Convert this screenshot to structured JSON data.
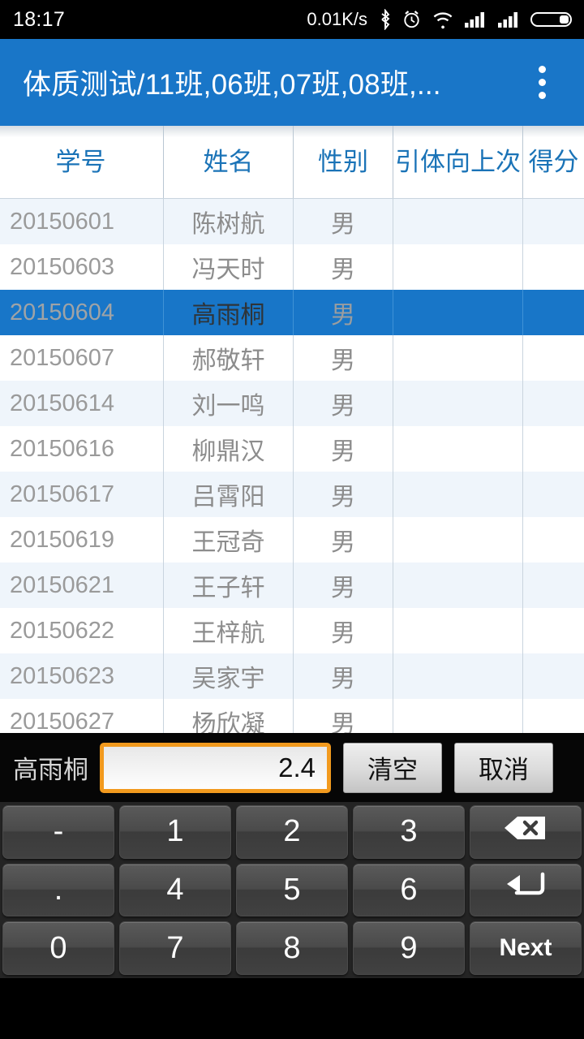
{
  "status_bar": {
    "time": "18:17",
    "network_speed": "0.01K/s",
    "icons": [
      "bluetooth-icon",
      "alarm-icon",
      "wifi-icon",
      "signal-icon",
      "signal-icon",
      "battery-icon"
    ]
  },
  "action_bar": {
    "title": "体质测试/11班,06班,07班,08班,...",
    "overflow_icon": "overflow-menu-icon"
  },
  "table": {
    "columns": [
      "学号",
      "姓名",
      "性别",
      "引体向上次",
      "得分"
    ],
    "rows": [
      {
        "id": "20150601",
        "name": "陈树航",
        "sex": "男",
        "pull": "",
        "score": "",
        "selected": false
      },
      {
        "id": "20150603",
        "name": "冯天时",
        "sex": "男",
        "pull": "",
        "score": "",
        "selected": false
      },
      {
        "id": "20150604",
        "name": "高雨桐",
        "sex": "男",
        "pull": "",
        "score": "",
        "selected": true
      },
      {
        "id": "20150607",
        "name": "郝敬轩",
        "sex": "男",
        "pull": "",
        "score": "",
        "selected": false
      },
      {
        "id": "20150614",
        "name": "刘一鸣",
        "sex": "男",
        "pull": "",
        "score": "",
        "selected": false
      },
      {
        "id": "20150616",
        "name": "柳鼎汉",
        "sex": "男",
        "pull": "",
        "score": "",
        "selected": false
      },
      {
        "id": "20150617",
        "name": "吕霄阳",
        "sex": "男",
        "pull": "",
        "score": "",
        "selected": false
      },
      {
        "id": "20150619",
        "name": "王冠奇",
        "sex": "男",
        "pull": "",
        "score": "",
        "selected": false
      },
      {
        "id": "20150621",
        "name": "王子轩",
        "sex": "男",
        "pull": "",
        "score": "",
        "selected": false
      },
      {
        "id": "20150622",
        "name": "王梓航",
        "sex": "男",
        "pull": "",
        "score": "",
        "selected": false
      },
      {
        "id": "20150623",
        "name": "吴家宇",
        "sex": "男",
        "pull": "",
        "score": "",
        "selected": false
      },
      {
        "id": "20150627",
        "name": "杨欣凝",
        "sex": "男",
        "pull": "",
        "score": "",
        "selected": false
      }
    ]
  },
  "input_bar": {
    "label": "高雨桐",
    "value": "2.4",
    "clear_label": "清空",
    "cancel_label": "取消"
  },
  "keypad": {
    "rows": [
      [
        {
          "label": "-",
          "name": "key-minus"
        },
        {
          "label": "1",
          "name": "key-1"
        },
        {
          "label": "2",
          "name": "key-2"
        },
        {
          "label": "3",
          "name": "key-3"
        },
        {
          "label": "",
          "name": "key-backspace",
          "icon": "backspace-icon"
        }
      ],
      [
        {
          "label": ".",
          "name": "key-dot"
        },
        {
          "label": "4",
          "name": "key-4"
        },
        {
          "label": "5",
          "name": "key-5"
        },
        {
          "label": "6",
          "name": "key-6"
        },
        {
          "label": "",
          "name": "key-enter",
          "icon": "enter-icon"
        }
      ],
      [
        {
          "label": "0",
          "name": "key-0"
        },
        {
          "label": "7",
          "name": "key-7"
        },
        {
          "label": "8",
          "name": "key-8"
        },
        {
          "label": "9",
          "name": "key-9"
        },
        {
          "label": "Next",
          "name": "key-next"
        }
      ]
    ]
  },
  "colors": {
    "accent": "#1976c8",
    "selected_row": "#1876c8",
    "header_text": "#1a73b7",
    "input_focus_border": "#f29a1e",
    "alt_row": "#eff5fb"
  }
}
